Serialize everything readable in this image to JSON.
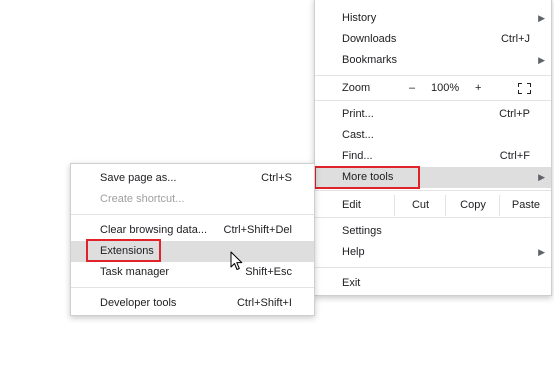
{
  "main_menu": {
    "history": {
      "label": "History"
    },
    "downloads": {
      "label": "Downloads",
      "shortcut": "Ctrl+J"
    },
    "bookmarks": {
      "label": "Bookmarks"
    },
    "zoom": {
      "label": "Zoom",
      "minus": "–",
      "value": "100%",
      "plus": "+"
    },
    "print": {
      "label": "Print...",
      "shortcut": "Ctrl+P"
    },
    "cast": {
      "label": "Cast..."
    },
    "find": {
      "label": "Find...",
      "shortcut": "Ctrl+F"
    },
    "more_tools": {
      "label": "More tools"
    },
    "edit": {
      "label": "Edit",
      "cut": "Cut",
      "copy": "Copy",
      "paste": "Paste"
    },
    "settings": {
      "label": "Settings"
    },
    "help": {
      "label": "Help"
    },
    "exit": {
      "label": "Exit"
    },
    "submenu_arrow": "▶"
  },
  "sub_menu": {
    "save_page": {
      "label": "Save page as...",
      "shortcut": "Ctrl+S"
    },
    "create_shortcut": {
      "label": "Create shortcut..."
    },
    "clear_browsing": {
      "label": "Clear browsing data...",
      "shortcut": "Ctrl+Shift+Del"
    },
    "extensions": {
      "label": "Extensions"
    },
    "task_manager": {
      "label": "Task manager",
      "shortcut": "Shift+Esc"
    },
    "developer_tools": {
      "label": "Developer tools",
      "shortcut": "Ctrl+Shift+I"
    }
  },
  "colors": {
    "highlight": "#dedede",
    "annotation_red": "#e0232a",
    "disabled_text": "#a0a0a0"
  },
  "icons": {
    "fullscreen": "fullscreen-icon",
    "arrow": "chevron-right-icon",
    "cursor": "mouse-pointer-icon"
  }
}
